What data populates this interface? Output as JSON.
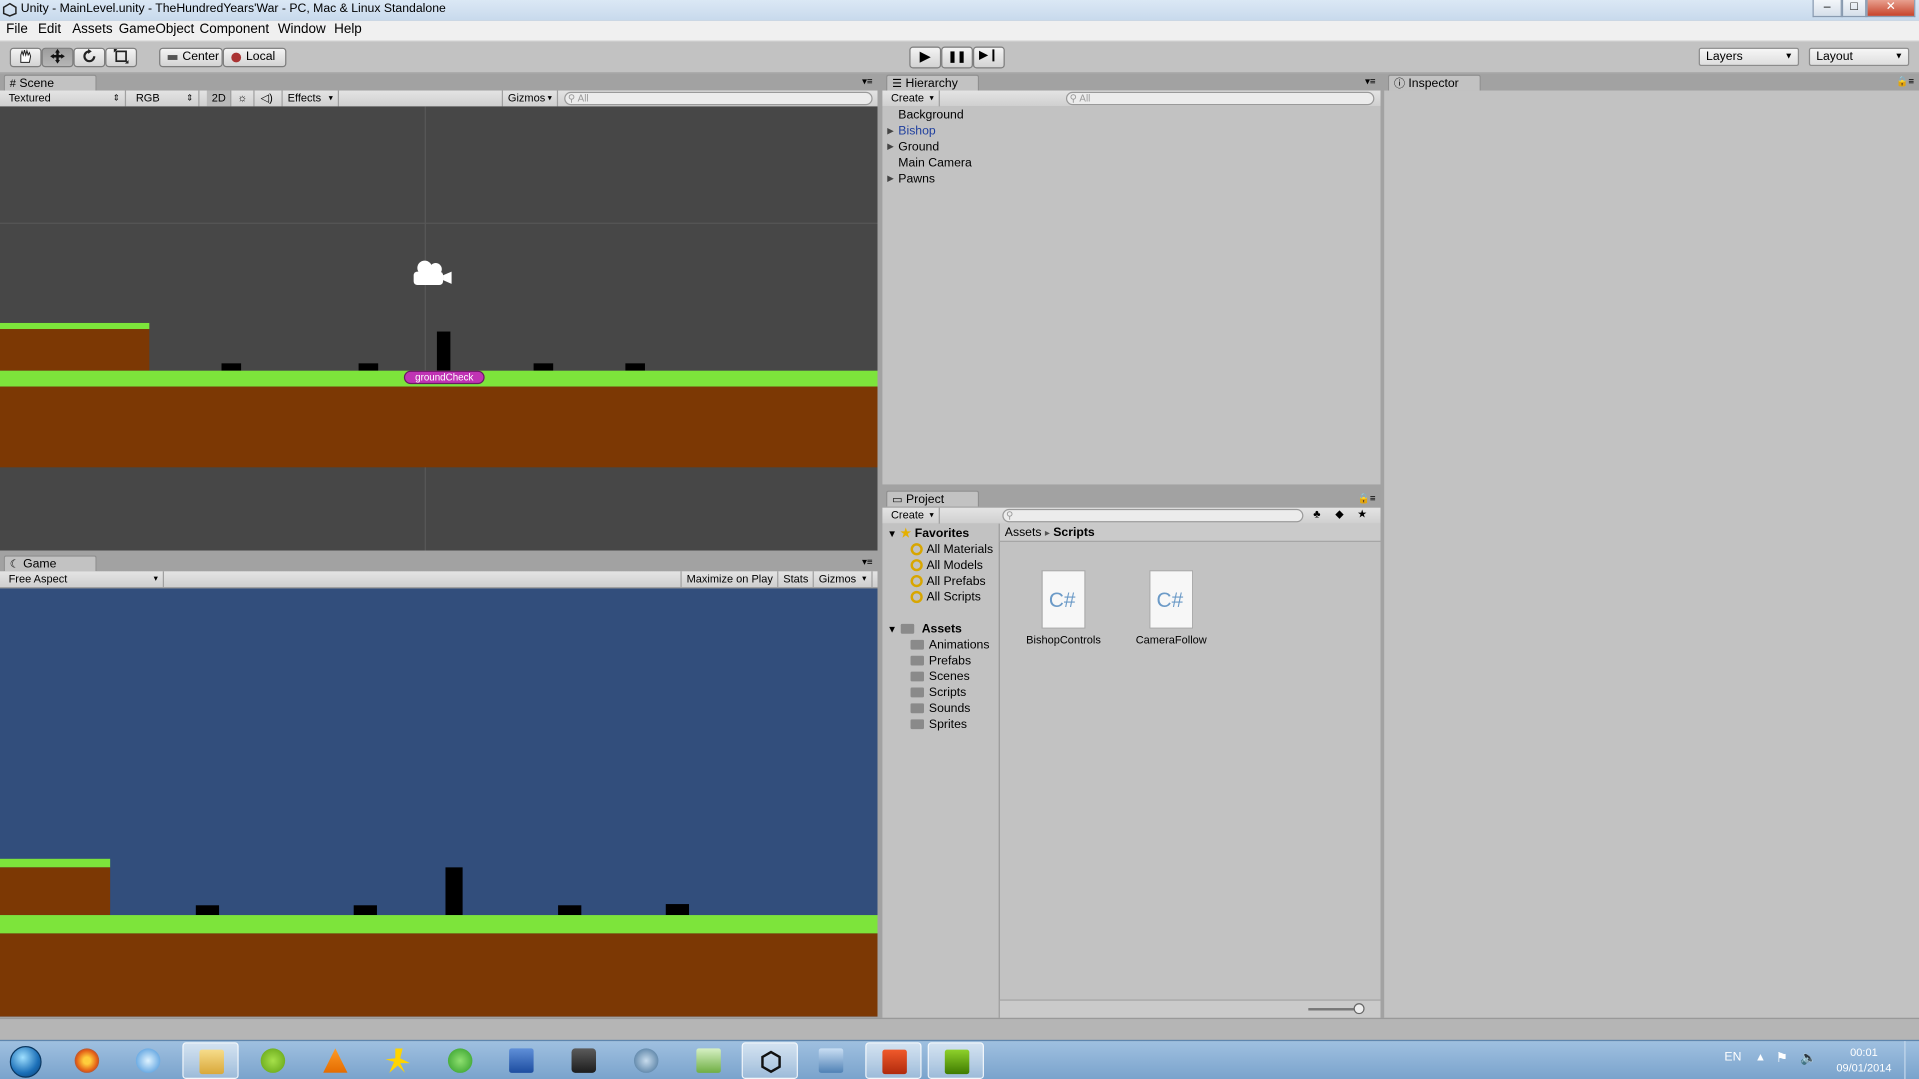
{
  "window": {
    "title": "Unity - MainLevel.unity - TheHundredYears'War - PC, Mac & Linux Standalone",
    "min": "–",
    "max": "□",
    "close": "✕"
  },
  "menu": [
    "File",
    "Edit",
    "Assets",
    "GameObject",
    "Component",
    "Window",
    "Help"
  ],
  "toolbar": {
    "center": "Center",
    "local": "Local",
    "layers": "Layers",
    "layout": "Layout",
    "play": "▶",
    "pause": "❚❚",
    "step": "▶❙"
  },
  "scene": {
    "tab": "Scene",
    "render_mode": "Textured",
    "color_mode": "RGB",
    "mode_2d": "2D",
    "effects": "Effects",
    "gizmos": "Gizmos",
    "search": "All",
    "label": "groundCheck"
  },
  "game": {
    "tab": "Game",
    "aspect": "Free Aspect",
    "maximize": "Maximize on Play",
    "stats": "Stats",
    "gizmos": "Gizmos"
  },
  "hierarchy": {
    "tab": "Hierarchy",
    "create": "Create",
    "search": "All",
    "items": [
      "Background",
      "Bishop",
      "Ground",
      "Main Camera",
      "Pawns"
    ],
    "selected_color": "#1f3f9e"
  },
  "project": {
    "tab": "Project",
    "create": "Create",
    "favorites_label": "Favorites",
    "favorites": [
      "All Materials",
      "All Models",
      "All Prefabs",
      "All Scripts"
    ],
    "assets_label": "Assets",
    "folders": [
      "Animations",
      "Prefabs",
      "Scenes",
      "Scripts",
      "Sounds",
      "Sprites"
    ],
    "breadcrumb_root": "Assets",
    "breadcrumb_sep": "▸",
    "breadcrumb_current": "Scripts",
    "files": [
      "BishopControls",
      "CameraFollow"
    ],
    "file_glyph": "C#"
  },
  "inspector": {
    "tab": "Inspector"
  },
  "tray": {
    "lang": "EN",
    "time": "00:01",
    "date": "09/01/2014"
  },
  "colors": {
    "ground_green": "#7de43b",
    "ground_brown": "#7c3804",
    "game_bg": "#324e7c",
    "scene_bg": "#474747"
  },
  "taskbar_icons": [
    "start-orb-icon",
    "firefox-icon",
    "itunes-icon",
    "file-explorer-icon",
    "spotify-icon",
    "vlc-icon",
    "aim-icon",
    "utorrent-icon",
    "word-icon",
    "steam-icon",
    "teamspeak-icon",
    "csharp-ide-icon",
    "unity-icon",
    "network-icon",
    "office-icon",
    "nvidia-icon"
  ]
}
